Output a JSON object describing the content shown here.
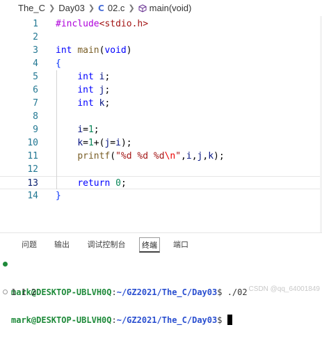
{
  "breadcrumb": {
    "folder1": "The_C",
    "folder2": "Day03",
    "file_icon_letter": "C",
    "file": "02.c",
    "symbol": "main(void)"
  },
  "editor": {
    "current_line": 13,
    "lines": [
      {
        "n": "1",
        "t": "#include<stdio.h>"
      },
      {
        "n": "2",
        "t": ""
      },
      {
        "n": "3",
        "t": "int main(void)"
      },
      {
        "n": "4",
        "t": "{"
      },
      {
        "n": "5",
        "t": "    int i;"
      },
      {
        "n": "6",
        "t": "    int j;"
      },
      {
        "n": "7",
        "t": "    int k;"
      },
      {
        "n": "8",
        "t": ""
      },
      {
        "n": "9",
        "t": "    i=1;"
      },
      {
        "n": "10",
        "t": "    k=1+(j=i);"
      },
      {
        "n": "11",
        "t": "    printf(\"%d %d %d\\n\",i,j,k);"
      },
      {
        "n": "12",
        "t": ""
      },
      {
        "n": "13",
        "t": "    return 0;"
      },
      {
        "n": "14",
        "t": "}"
      }
    ]
  },
  "panel": {
    "tabs": [
      "问题",
      "输出",
      "调试控制台",
      "终端",
      "端口"
    ],
    "active_tab": "终端"
  },
  "terminal": {
    "user": "mark@DESKTOP-UBLVH0Q",
    "path": "~/GZ2021/The_C/Day03",
    "prompt_symbol": "$",
    "command": "./02",
    "output": "1 1 2"
  },
  "watermark": "CSDN @qq_64001849",
  "colors": {
    "keyword": "#0000ff",
    "preprocessor": "#af00db",
    "string": "#a31515",
    "number": "#098658",
    "terminal_user": "#1e8a3a",
    "terminal_path": "#2a4fd0"
  }
}
